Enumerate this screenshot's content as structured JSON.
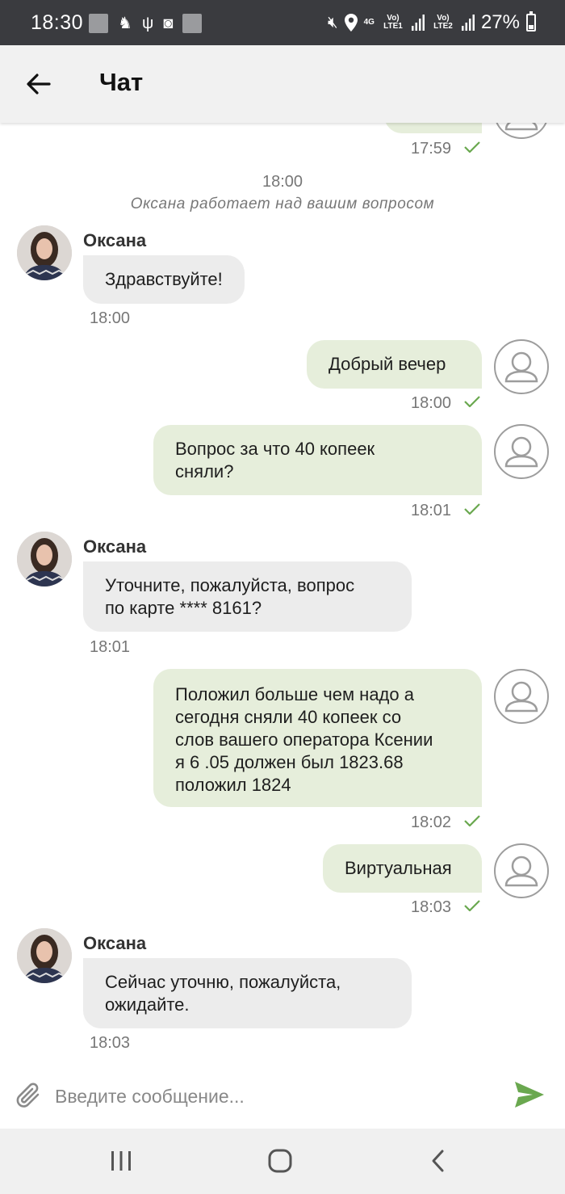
{
  "status_bar": {
    "time": "18:30",
    "net_4g": "4G",
    "sim1": "Vo) LTE1",
    "sim2": "Vo) LTE2",
    "battery": "27%"
  },
  "appbar": {
    "title": "Чат"
  },
  "chat": {
    "top_partial_time": "17:59",
    "system": {
      "time": "18:00",
      "note": "Оксана работает над вашим вопросом"
    },
    "messages": [
      {
        "sender": "Оксана",
        "text": "Здравствуйте!",
        "time": "18:00"
      },
      {
        "text": "Добрый вечер",
        "time": "18:00"
      },
      {
        "line1": "Вопрос за что 40 копеек",
        "line2": "сняли?",
        "time": "18:01"
      },
      {
        "sender": "Оксана",
        "line1": "Уточните, пожалуйста, вопрос",
        "line2": "по карте **** 8161?",
        "time": "18:01"
      },
      {
        "lines": [
          "Положил больше чем надо а",
          "сегодня сняли 40 копеек со",
          "слов вашего оператора Ксении",
          "я 6 .05 должен был 1823.68",
          "положил 1824"
        ],
        "time": "18:02"
      },
      {
        "text": "Виртуальная",
        "time": "18:03"
      },
      {
        "sender": "Оксана",
        "line1": "Сейчас уточню, пожалуйста,",
        "line2": "ожидайте.",
        "time": "18:03"
      }
    ]
  },
  "input": {
    "placeholder": "Введите сообщение..."
  },
  "colors": {
    "status_bar": "#3a3b3f",
    "appbar": "#f1f1f1",
    "outgoing_bubble": "#e6eedb",
    "incoming_bubble": "#ececec",
    "accent_green": "#6aa84f"
  },
  "icons": {
    "back": "arrow-left-icon",
    "attach": "paperclip-icon",
    "send": "send-icon",
    "check": "check-icon",
    "user": "user-avatar-icon"
  }
}
